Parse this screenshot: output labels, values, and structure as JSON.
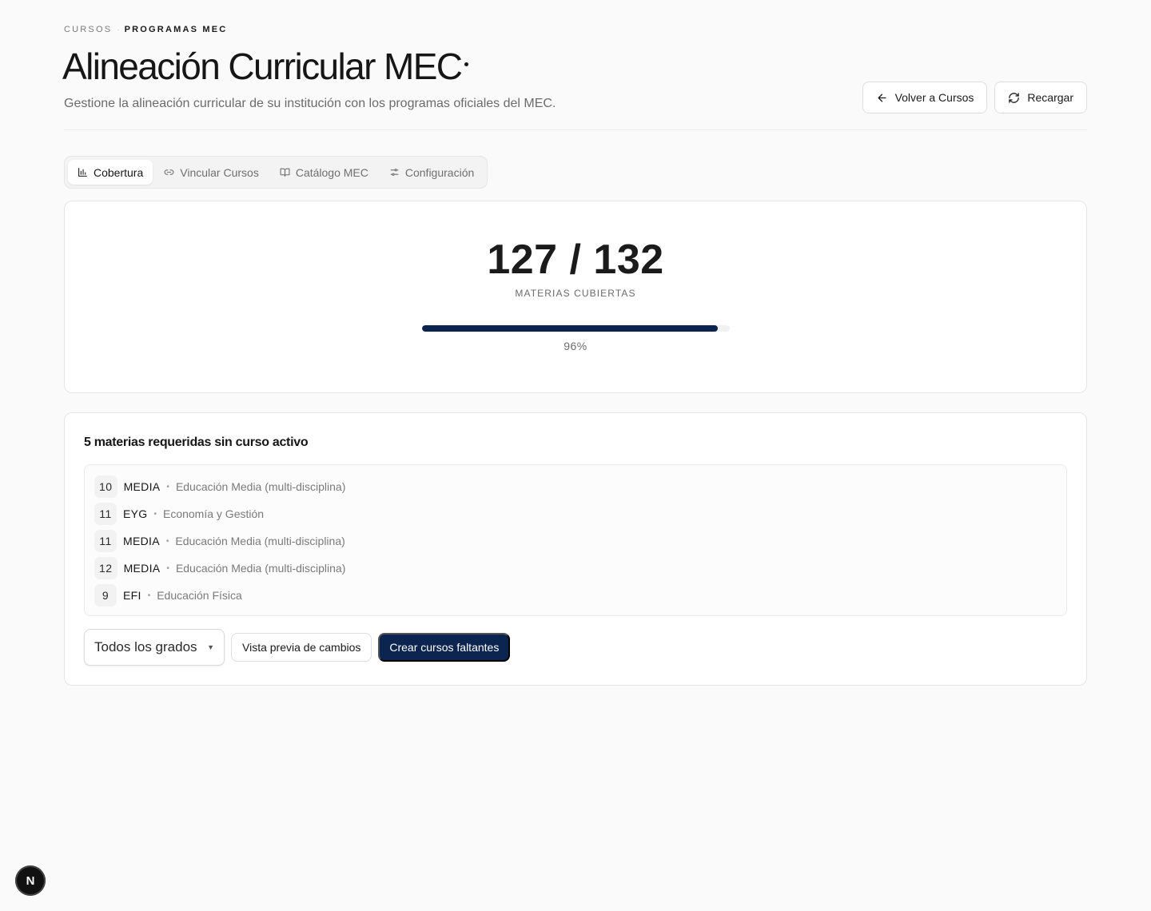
{
  "breadcrumb": {
    "parent": "CURSOS",
    "separator": "·",
    "current": "PROGRAMAS MEC"
  },
  "header": {
    "title": "Alineación Curricular MEC",
    "subtitle": "Gestione la alineación curricular de su institución con los programas oficiales del MEC.",
    "back_label": "Volver a Cursos",
    "reload_label": "Recargar"
  },
  "tabs": [
    {
      "label": "Cobertura",
      "icon": "bar-chart-icon",
      "active": true
    },
    {
      "label": "Vincular Cursos",
      "icon": "link-icon",
      "active": false
    },
    {
      "label": "Catálogo MEC",
      "icon": "book-open-icon",
      "active": false
    },
    {
      "label": "Configuración",
      "icon": "sliders-icon",
      "active": false
    }
  ],
  "coverage": {
    "count": "127 / 132",
    "label": "MATERIAS CUBIERTAS",
    "percent_text": "96%",
    "progress": 0.96,
    "bar_color": "#0c2550"
  },
  "missing": {
    "title": "5 materias requeridas sin curso activo",
    "items": [
      {
        "grade": "10",
        "code": "MEDIA",
        "name": "Educación Media (multi-disciplina)"
      },
      {
        "grade": "11",
        "code": "EYG",
        "name": "Economía y Gestión"
      },
      {
        "grade": "11",
        "code": "MEDIA",
        "name": "Educación Media (multi-disciplina)"
      },
      {
        "grade": "12",
        "code": "MEDIA",
        "name": "Educación Media (multi-disciplina)"
      },
      {
        "grade": "9",
        "code": "EFI",
        "name": "Educación Física"
      }
    ],
    "row_separator": "•",
    "grade_filter": "Todos los grados",
    "preview_label": "Vista previa de cambios",
    "create_label": "Crear cursos faltantes"
  },
  "dev_badge": "N",
  "colors": {
    "primary": "#0c2550",
    "background": "#fafafa"
  }
}
